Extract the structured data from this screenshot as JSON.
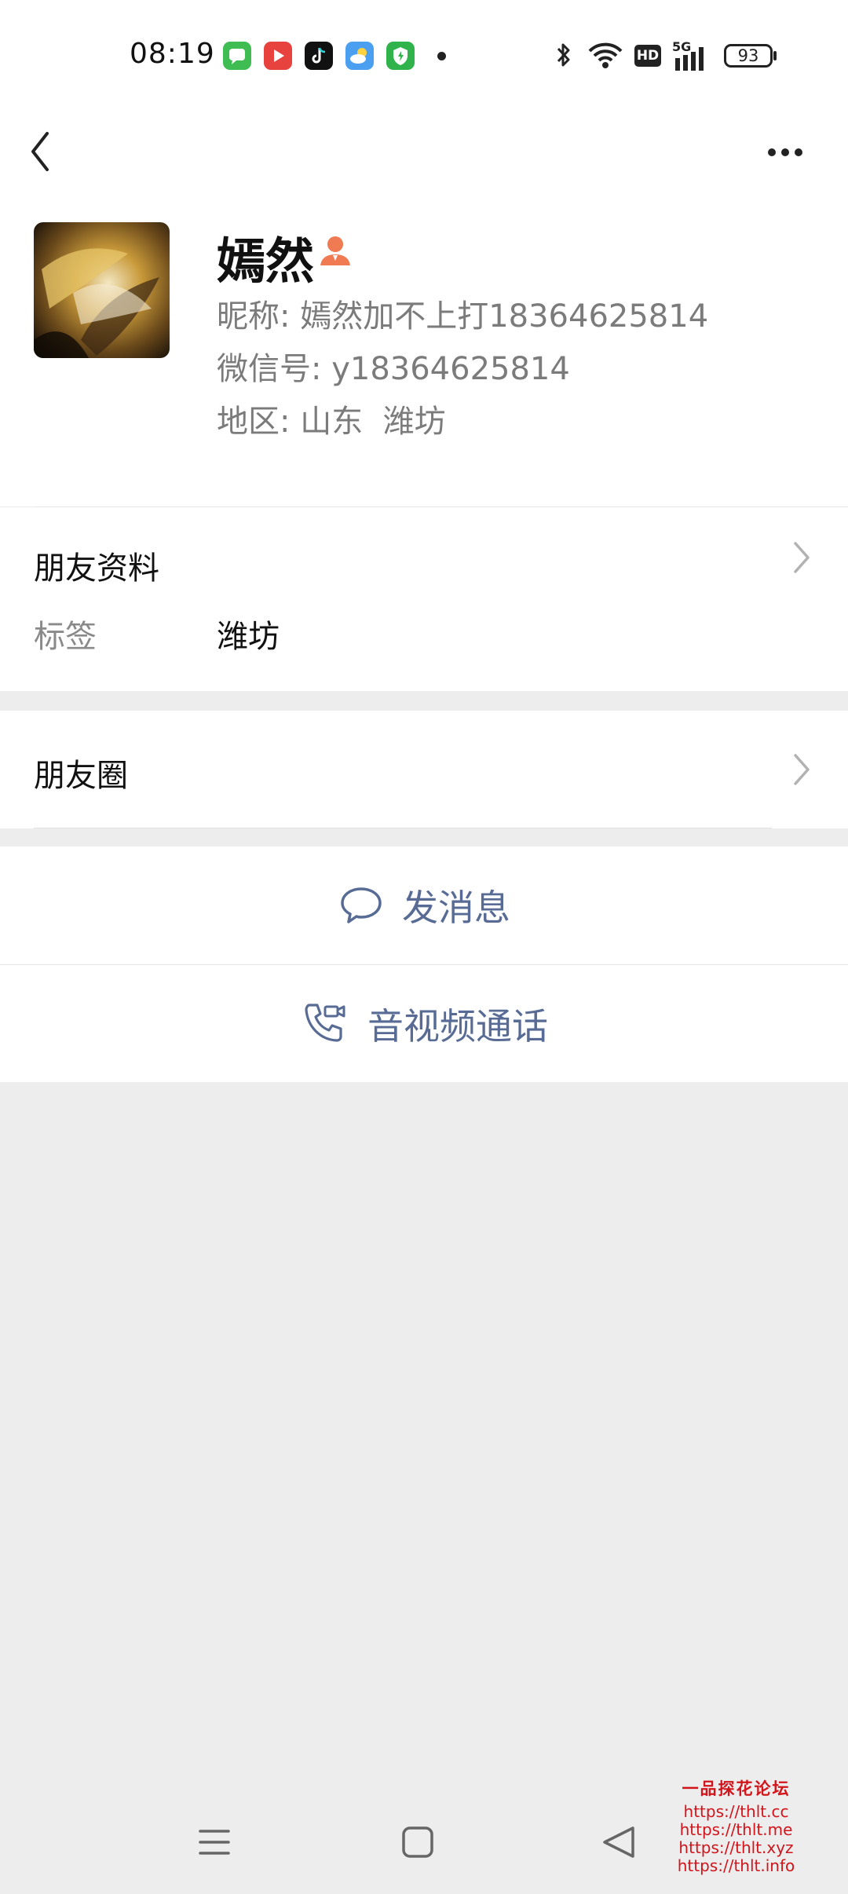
{
  "status_bar": {
    "time": "08:19",
    "apps": [
      {
        "icon": "messages-app-icon",
        "color": "#3fbd52"
      },
      {
        "icon": "video-app-icon",
        "color": "#e8423f"
      },
      {
        "icon": "tiktok-app-icon",
        "color": "#111111"
      },
      {
        "icon": "weather-app-icon",
        "color": "#4a9ff0"
      },
      {
        "icon": "security-app-icon",
        "color": "#2fb34a"
      }
    ],
    "network": "5G",
    "hd": "HD",
    "battery": "93"
  },
  "nav": {
    "back_icon": "chevron-left-icon",
    "more_icon": "more-dots-icon"
  },
  "profile": {
    "name": "嫣然",
    "badge_icon": "person-badge-icon",
    "nickname_label": "昵称:",
    "nickname": "嫣然加不上打18364625814",
    "wechat_id_label": "微信号:",
    "wechat_id": "y18364625814",
    "region_label": "地区:",
    "region": "山东  潍坊"
  },
  "friend_info": {
    "title": "朋友资料",
    "tag_label": "标签",
    "tag_value": "潍坊"
  },
  "moments": {
    "title": "朋友圈"
  },
  "actions": {
    "message": "发消息",
    "call": "音视频通话"
  },
  "colors": {
    "link_blue": "#576b95",
    "background": "#ededed",
    "badge_orange": "#f07a52",
    "watermark_red": "#d2141b"
  },
  "watermark": {
    "title": "一品探花论坛",
    "links": [
      "https://thlt.cc",
      "https://thlt.me",
      "https://thlt.xyz",
      "https://thlt.info"
    ]
  }
}
